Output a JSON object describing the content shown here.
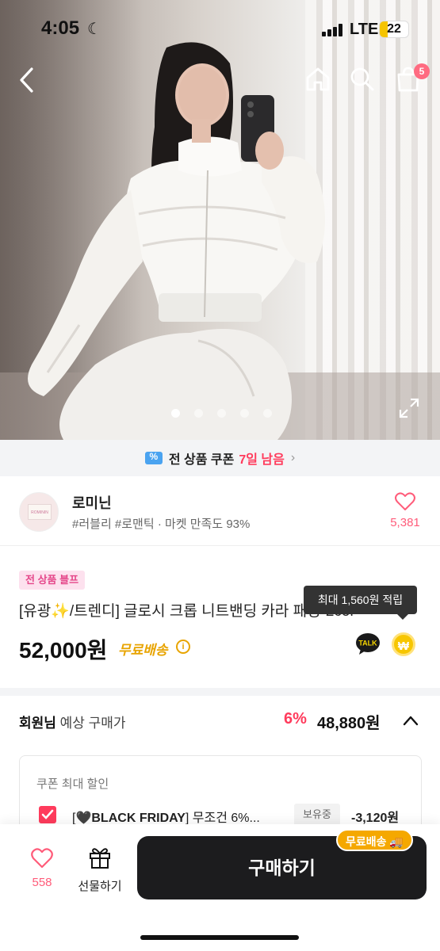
{
  "status_bar": {
    "time": "4:05",
    "network": "LTE",
    "battery": "22"
  },
  "header": {
    "cart_count": "5"
  },
  "carousel": {
    "dot_count": 5,
    "active_index": 0
  },
  "coupon_banner": {
    "label": "전 상품 쿠폰",
    "remaining": "7일 남음"
  },
  "store": {
    "logo_text": "ROMININ",
    "name": "로미닌",
    "tags": "#러블리 #로맨틱 · 마켓 만족도 93%",
    "likes": "5,381"
  },
  "product": {
    "tag": "전 상품 블프",
    "title": "[유광✨/트렌디] 글로시 크롭 니트밴딩 카라 패딩-2col",
    "price": "52,000원",
    "shipping": "무료배송",
    "info_icon": "i",
    "reward_tooltip": "최대 1,560원 적립",
    "talk_icon_label": "TALK",
    "coin_symbol": "₩"
  },
  "member_price": {
    "label_bold": "회원님",
    "label_rest": " 예상 구매가",
    "discount": "6%",
    "price": "48,880원"
  },
  "coupon": {
    "header": "쿠폰 최대 할인",
    "name_prefix": "[🖤",
    "name_bold": "BLACK FRIDAY",
    "name_suffix": "] 무조건 6%...",
    "status": "보유중",
    "amount": "-3,120원"
  },
  "bottom_bar": {
    "likes": "558",
    "gift_label": "선물하기",
    "buy_label": "구매하기",
    "shipping_badge": "무료배송 🚚"
  }
}
